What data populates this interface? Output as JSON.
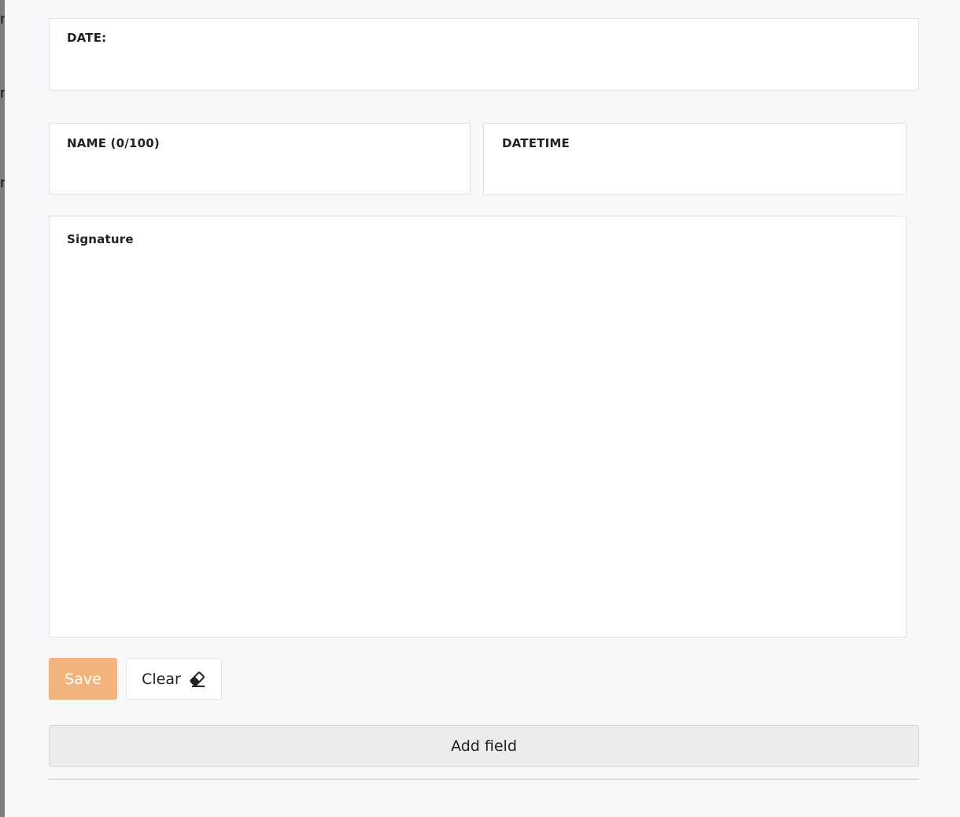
{
  "backdrop": {
    "letters": [
      "n",
      "n",
      "r"
    ]
  },
  "fields": {
    "date_label": "DATE:",
    "name_label": "NAME (0/100)",
    "datetime_label": "DATETIME",
    "signature_label": "Signature"
  },
  "actions": {
    "save_label": "Save",
    "clear_label": "Clear",
    "clear_icon": "eraser-icon",
    "add_field_label": "Add field"
  },
  "colors": {
    "save_button": "#f2b47c",
    "background": "#f7f8fa"
  }
}
